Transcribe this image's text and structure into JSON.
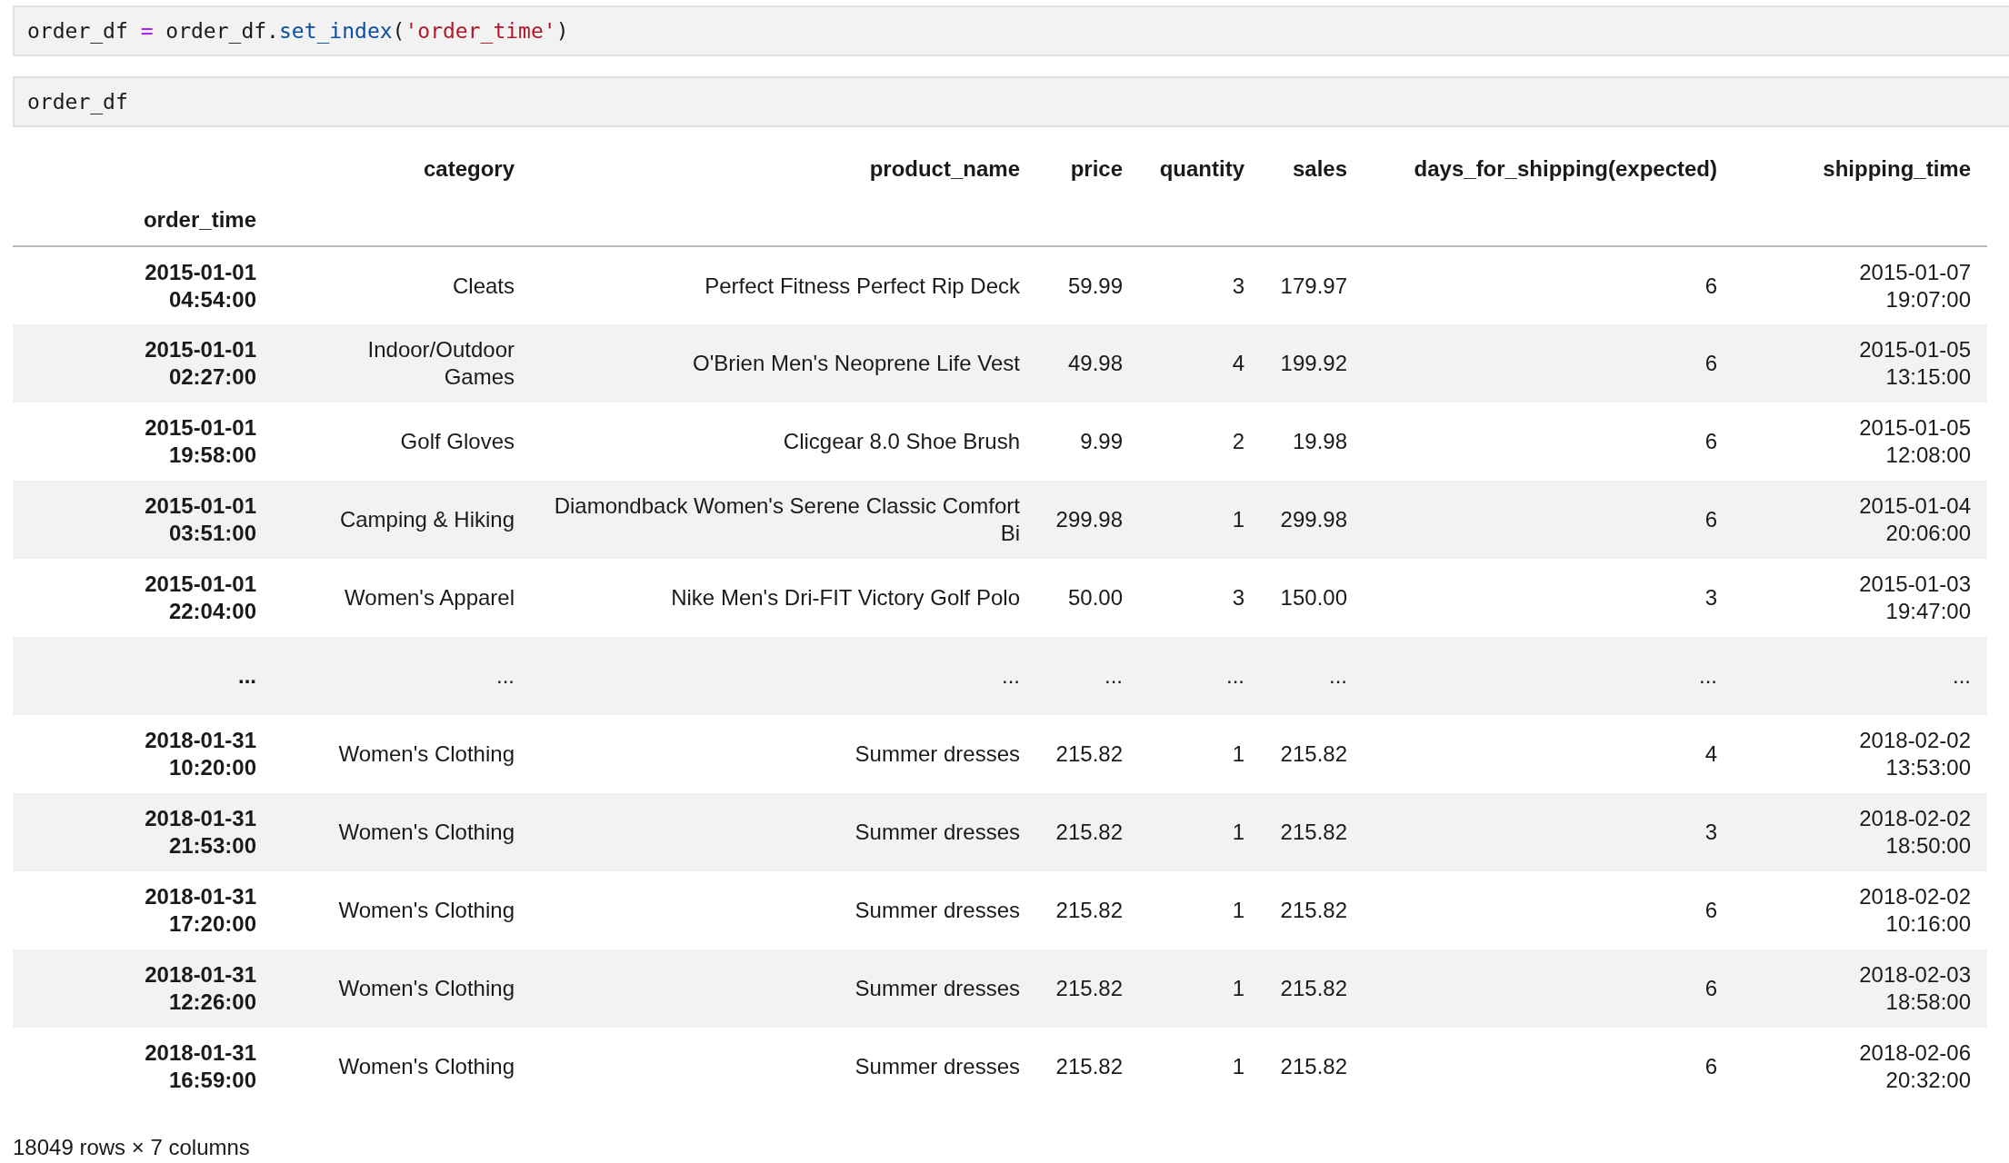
{
  "cells": [
    {
      "tokens": [
        {
          "text": "order_df ",
          "kind": "name"
        },
        {
          "text": "=",
          "kind": "operator"
        },
        {
          "text": " order_df.",
          "kind": "name"
        },
        {
          "text": "set_index",
          "kind": "method"
        },
        {
          "text": "(",
          "kind": "name"
        },
        {
          "text": "'order_time'",
          "kind": "string"
        },
        {
          "text": ")",
          "kind": "name"
        }
      ]
    },
    {
      "tokens": [
        {
          "text": "order_df",
          "kind": "name"
        }
      ]
    }
  ],
  "table": {
    "columns": [
      "category",
      "product_name",
      "price",
      "quantity",
      "sales",
      "days_for_shipping(expected)",
      "shipping_time"
    ],
    "index_name": "order_time",
    "rows": [
      {
        "index": "2015-01-01 04:54:00",
        "cells": [
          "Cleats",
          "Perfect Fitness Perfect Rip Deck",
          "59.99",
          "3",
          "179.97",
          "6",
          "2015-01-07 19:07:00"
        ]
      },
      {
        "index": "2015-01-01 02:27:00",
        "cells": [
          "Indoor/Outdoor Games",
          "O'Brien Men's Neoprene Life Vest",
          "49.98",
          "4",
          "199.92",
          "6",
          "2015-01-05 13:15:00"
        ]
      },
      {
        "index": "2015-01-01 19:58:00",
        "cells": [
          "Golf Gloves",
          "Clicgear 8.0 Shoe Brush",
          "9.99",
          "2",
          "19.98",
          "6",
          "2015-01-05 12:08:00"
        ]
      },
      {
        "index": "2015-01-01 03:51:00",
        "cells": [
          "Camping & Hiking",
          "Diamondback Women's Serene Classic Comfort Bi",
          "299.98",
          "1",
          "299.98",
          "6",
          "2015-01-04 20:06:00"
        ]
      },
      {
        "index": "2015-01-01 22:04:00",
        "cells": [
          "Women's Apparel",
          "Nike Men's Dri-FIT Victory Golf Polo",
          "50.00",
          "3",
          "150.00",
          "3",
          "2015-01-03 19:47:00"
        ]
      },
      {
        "index": "...",
        "cells": [
          "...",
          "...",
          "...",
          "...",
          "...",
          "...",
          "..."
        ]
      },
      {
        "index": "2018-01-31 10:20:00",
        "cells": [
          "Women's Clothing",
          "Summer dresses",
          "215.82",
          "1",
          "215.82",
          "4",
          "2018-02-02 13:53:00"
        ]
      },
      {
        "index": "2018-01-31 21:53:00",
        "cells": [
          "Women's Clothing",
          "Summer dresses",
          "215.82",
          "1",
          "215.82",
          "3",
          "2018-02-02 18:50:00"
        ]
      },
      {
        "index": "2018-01-31 17:20:00",
        "cells": [
          "Women's Clothing",
          "Summer dresses",
          "215.82",
          "1",
          "215.82",
          "6",
          "2018-02-02 10:16:00"
        ]
      },
      {
        "index": "2018-01-31 12:26:00",
        "cells": [
          "Women's Clothing",
          "Summer dresses",
          "215.82",
          "1",
          "215.82",
          "6",
          "2018-02-03 18:58:00"
        ]
      },
      {
        "index": "2018-01-31 16:59:00",
        "cells": [
          "Women's Clothing",
          "Summer dresses",
          "215.82",
          "1",
          "215.82",
          "6",
          "2018-02-06 20:32:00"
        ]
      }
    ]
  },
  "shape": "18049 rows × 7 columns"
}
